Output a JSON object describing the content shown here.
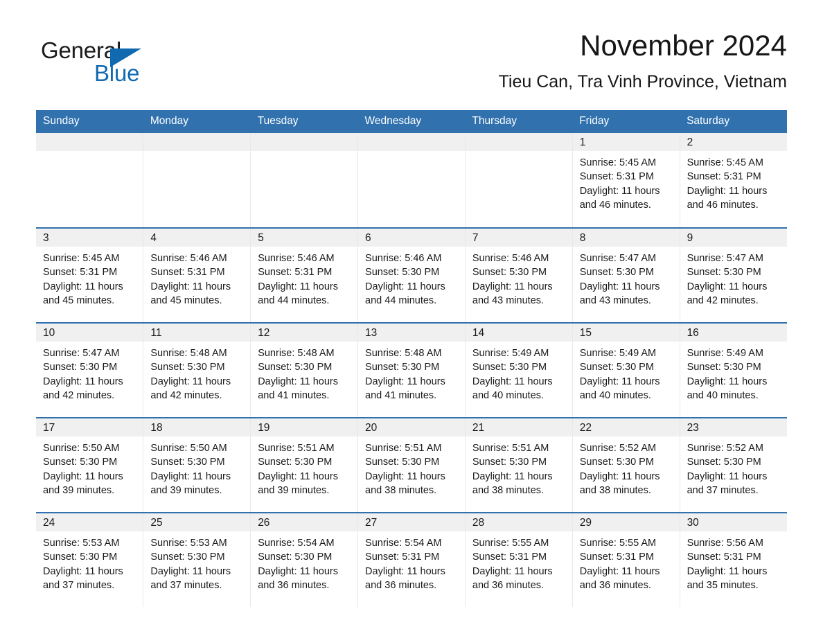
{
  "brand": {
    "name_part1": "General",
    "name_part2": "Blue",
    "accent_color": "#1169b0",
    "triangle_icon": "brand-triangle-icon"
  },
  "header": {
    "month_title": "November 2024",
    "location": "Tieu Can, Tra Vinh Province, Vietnam"
  },
  "theme": {
    "header_blue": "#3071ae",
    "daynum_strip_gray": "#f0f0f0",
    "divider_gray": "#e8e8e8",
    "text_color": "#1a1a1a"
  },
  "weekday_headers": [
    "Sunday",
    "Monday",
    "Tuesday",
    "Wednesday",
    "Thursday",
    "Friday",
    "Saturday"
  ],
  "labels": {
    "sunrise_prefix": "Sunrise:",
    "sunset_prefix": "Sunset:",
    "daylight_prefix": "Daylight:"
  },
  "weeks": [
    [
      {
        "empty": true
      },
      {
        "empty": true
      },
      {
        "empty": true
      },
      {
        "empty": true
      },
      {
        "empty": true
      },
      {
        "empty": false,
        "day": "1",
        "sunrise": "Sunrise: 5:45 AM",
        "sunset": "Sunset: 5:31 PM",
        "daylight_line1": "Daylight: 11 hours",
        "daylight_line2": "and 46 minutes."
      },
      {
        "empty": false,
        "day": "2",
        "sunrise": "Sunrise: 5:45 AM",
        "sunset": "Sunset: 5:31 PM",
        "daylight_line1": "Daylight: 11 hours",
        "daylight_line2": "and 46 minutes."
      }
    ],
    [
      {
        "empty": false,
        "day": "3",
        "sunrise": "Sunrise: 5:45 AM",
        "sunset": "Sunset: 5:31 PM",
        "daylight_line1": "Daylight: 11 hours",
        "daylight_line2": "and 45 minutes."
      },
      {
        "empty": false,
        "day": "4",
        "sunrise": "Sunrise: 5:46 AM",
        "sunset": "Sunset: 5:31 PM",
        "daylight_line1": "Daylight: 11 hours",
        "daylight_line2": "and 45 minutes."
      },
      {
        "empty": false,
        "day": "5",
        "sunrise": "Sunrise: 5:46 AM",
        "sunset": "Sunset: 5:31 PM",
        "daylight_line1": "Daylight: 11 hours",
        "daylight_line2": "and 44 minutes."
      },
      {
        "empty": false,
        "day": "6",
        "sunrise": "Sunrise: 5:46 AM",
        "sunset": "Sunset: 5:30 PM",
        "daylight_line1": "Daylight: 11 hours",
        "daylight_line2": "and 44 minutes."
      },
      {
        "empty": false,
        "day": "7",
        "sunrise": "Sunrise: 5:46 AM",
        "sunset": "Sunset: 5:30 PM",
        "daylight_line1": "Daylight: 11 hours",
        "daylight_line2": "and 43 minutes."
      },
      {
        "empty": false,
        "day": "8",
        "sunrise": "Sunrise: 5:47 AM",
        "sunset": "Sunset: 5:30 PM",
        "daylight_line1": "Daylight: 11 hours",
        "daylight_line2": "and 43 minutes."
      },
      {
        "empty": false,
        "day": "9",
        "sunrise": "Sunrise: 5:47 AM",
        "sunset": "Sunset: 5:30 PM",
        "daylight_line1": "Daylight: 11 hours",
        "daylight_line2": "and 42 minutes."
      }
    ],
    [
      {
        "empty": false,
        "day": "10",
        "sunrise": "Sunrise: 5:47 AM",
        "sunset": "Sunset: 5:30 PM",
        "daylight_line1": "Daylight: 11 hours",
        "daylight_line2": "and 42 minutes."
      },
      {
        "empty": false,
        "day": "11",
        "sunrise": "Sunrise: 5:48 AM",
        "sunset": "Sunset: 5:30 PM",
        "daylight_line1": "Daylight: 11 hours",
        "daylight_line2": "and 42 minutes."
      },
      {
        "empty": false,
        "day": "12",
        "sunrise": "Sunrise: 5:48 AM",
        "sunset": "Sunset: 5:30 PM",
        "daylight_line1": "Daylight: 11 hours",
        "daylight_line2": "and 41 minutes."
      },
      {
        "empty": false,
        "day": "13",
        "sunrise": "Sunrise: 5:48 AM",
        "sunset": "Sunset: 5:30 PM",
        "daylight_line1": "Daylight: 11 hours",
        "daylight_line2": "and 41 minutes."
      },
      {
        "empty": false,
        "day": "14",
        "sunrise": "Sunrise: 5:49 AM",
        "sunset": "Sunset: 5:30 PM",
        "daylight_line1": "Daylight: 11 hours",
        "daylight_line2": "and 40 minutes."
      },
      {
        "empty": false,
        "day": "15",
        "sunrise": "Sunrise: 5:49 AM",
        "sunset": "Sunset: 5:30 PM",
        "daylight_line1": "Daylight: 11 hours",
        "daylight_line2": "and 40 minutes."
      },
      {
        "empty": false,
        "day": "16",
        "sunrise": "Sunrise: 5:49 AM",
        "sunset": "Sunset: 5:30 PM",
        "daylight_line1": "Daylight: 11 hours",
        "daylight_line2": "and 40 minutes."
      }
    ],
    [
      {
        "empty": false,
        "day": "17",
        "sunrise": "Sunrise: 5:50 AM",
        "sunset": "Sunset: 5:30 PM",
        "daylight_line1": "Daylight: 11 hours",
        "daylight_line2": "and 39 minutes."
      },
      {
        "empty": false,
        "day": "18",
        "sunrise": "Sunrise: 5:50 AM",
        "sunset": "Sunset: 5:30 PM",
        "daylight_line1": "Daylight: 11 hours",
        "daylight_line2": "and 39 minutes."
      },
      {
        "empty": false,
        "day": "19",
        "sunrise": "Sunrise: 5:51 AM",
        "sunset": "Sunset: 5:30 PM",
        "daylight_line1": "Daylight: 11 hours",
        "daylight_line2": "and 39 minutes."
      },
      {
        "empty": false,
        "day": "20",
        "sunrise": "Sunrise: 5:51 AM",
        "sunset": "Sunset: 5:30 PM",
        "daylight_line1": "Daylight: 11 hours",
        "daylight_line2": "and 38 minutes."
      },
      {
        "empty": false,
        "day": "21",
        "sunrise": "Sunrise: 5:51 AM",
        "sunset": "Sunset: 5:30 PM",
        "daylight_line1": "Daylight: 11 hours",
        "daylight_line2": "and 38 minutes."
      },
      {
        "empty": false,
        "day": "22",
        "sunrise": "Sunrise: 5:52 AM",
        "sunset": "Sunset: 5:30 PM",
        "daylight_line1": "Daylight: 11 hours",
        "daylight_line2": "and 38 minutes."
      },
      {
        "empty": false,
        "day": "23",
        "sunrise": "Sunrise: 5:52 AM",
        "sunset": "Sunset: 5:30 PM",
        "daylight_line1": "Daylight: 11 hours",
        "daylight_line2": "and 37 minutes."
      }
    ],
    [
      {
        "empty": false,
        "day": "24",
        "sunrise": "Sunrise: 5:53 AM",
        "sunset": "Sunset: 5:30 PM",
        "daylight_line1": "Daylight: 11 hours",
        "daylight_line2": "and 37 minutes."
      },
      {
        "empty": false,
        "day": "25",
        "sunrise": "Sunrise: 5:53 AM",
        "sunset": "Sunset: 5:30 PM",
        "daylight_line1": "Daylight: 11 hours",
        "daylight_line2": "and 37 minutes."
      },
      {
        "empty": false,
        "day": "26",
        "sunrise": "Sunrise: 5:54 AM",
        "sunset": "Sunset: 5:30 PM",
        "daylight_line1": "Daylight: 11 hours",
        "daylight_line2": "and 36 minutes."
      },
      {
        "empty": false,
        "day": "27",
        "sunrise": "Sunrise: 5:54 AM",
        "sunset": "Sunset: 5:31 PM",
        "daylight_line1": "Daylight: 11 hours",
        "daylight_line2": "and 36 minutes."
      },
      {
        "empty": false,
        "day": "28",
        "sunrise": "Sunrise: 5:55 AM",
        "sunset": "Sunset: 5:31 PM",
        "daylight_line1": "Daylight: 11 hours",
        "daylight_line2": "and 36 minutes."
      },
      {
        "empty": false,
        "day": "29",
        "sunrise": "Sunrise: 5:55 AM",
        "sunset": "Sunset: 5:31 PM",
        "daylight_line1": "Daylight: 11 hours",
        "daylight_line2": "and 36 minutes."
      },
      {
        "empty": false,
        "day": "30",
        "sunrise": "Sunrise: 5:56 AM",
        "sunset": "Sunset: 5:31 PM",
        "daylight_line1": "Daylight: 11 hours",
        "daylight_line2": "and 35 minutes."
      }
    ]
  ]
}
